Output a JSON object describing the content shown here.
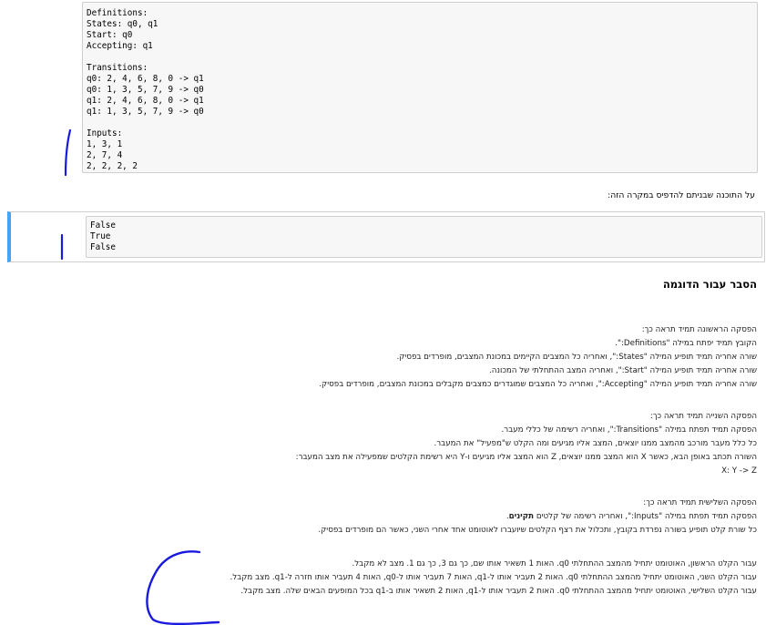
{
  "code_cell": {
    "lines": [
      "Definitions:",
      "States: q0, q1",
      "Start: q0",
      "Accepting: q1",
      "",
      "Transitions:",
      "q0: 2, 4, 6, 8, 0 -> q1",
      "q0: 1, 3, 5, 7, 9 -> q0",
      "q1: 2, 4, 6, 8, 0 -> q1",
      "q1: 1, 3, 5, 7, 9 -> q0",
      "",
      "Inputs:",
      "1, 3, 1",
      "2, 7, 4",
      "2, 2, 2, 2"
    ]
  },
  "question_text": "על התוכנה שבניתם להדפיס במקרה הזה:",
  "answer_cell": {
    "lines": [
      "False",
      "True",
      "False"
    ]
  },
  "section_title": "הסבר עבור הדוגמה",
  "paragraph1": [
    "הפסקה הראשונה תמיד תראה כך:",
    "הקובץ תמיד יפתח במילה \"Definitions:\".",
    "שורה אחריה תמיד תופיע המילה \"States:\", ואחריה כל המצבים הקיימים במכונת המצבים, מופרדים בפסיק.",
    "שורה אחריה תמיד תופיע המילה \"Start:\", ואחריה המצב ההתחלתי של המכונה.",
    "שורה אחריה תמיד תופיע המילה \"Accepting:\", ואחריה כל המצבים שמוגדרים כמצבים מקבלים במכונת המצבים, מופרדים בפסיק."
  ],
  "paragraph2": [
    "הפסקה השנייה תמיד תראה כך:",
    "הפסקה תמיד תפתח במילה \"Transitions:\", ואחריה רשימה של כללי מעבר.",
    "כל כלל מעבר מורכב מהמצב ממנו יוצאים, המצב אליו מגיעים ומה הקלט ש\"מפעיל\" את המעבר.",
    "השורה תכתב באופן הבא, כאשר X הוא המצב ממנו יוצאים, Z הוא המצב אליו מגיעים ו-Y היא רשימת הקלטים שמפעילה את מצב המעבר:",
    "X: Y -> Z"
  ],
  "paragraph3": {
    "title": "הפסקה השלישית תמיד תראה כך:",
    "line2_prefix": "הפסקה תמיד תפתח במילה \"Inputs:\", ואחריה רשימה של קלטים ",
    "line2_bold": "תקינים",
    "line2_suffix": ".",
    "line3": "כל שורת קלט תופיע בשורה נפרדת בקובץ, ותכלול את רצף הקלטים שיועברו לאוטומט אחד אחרי השני, כאשר הם מופרדים בפסיק."
  },
  "paragraph4": [
    "עבור הקלט הראשון, האוטומט יתחיל מהמצב ההתחלתי q0. האות 1 תשאיר אותו שם, כך גם 3, כך גם 1. מצב לא מקבל.",
    "עבור הקלט השני, האוטומט יתחיל מהמצב ההתחלתי q0. האות 2 תעביר אותו ל-q1, האות 7 תעביר אותו ל-q0, האות 4 תעביר אותו חזרה ל-q1. מצב מקבל.",
    "עבור הקלט השלישי, האוטומט יתחיל מהמצב ההתחלתי q0. האות 2 תעביר אותו ל-q1, האות 2 תשאיר אותו ב-q1 בכל המופעים הבאים שלה. מצב מקבל."
  ],
  "colors": {
    "accent_bar": "#42a5f5",
    "ink": "#1a1adf"
  }
}
